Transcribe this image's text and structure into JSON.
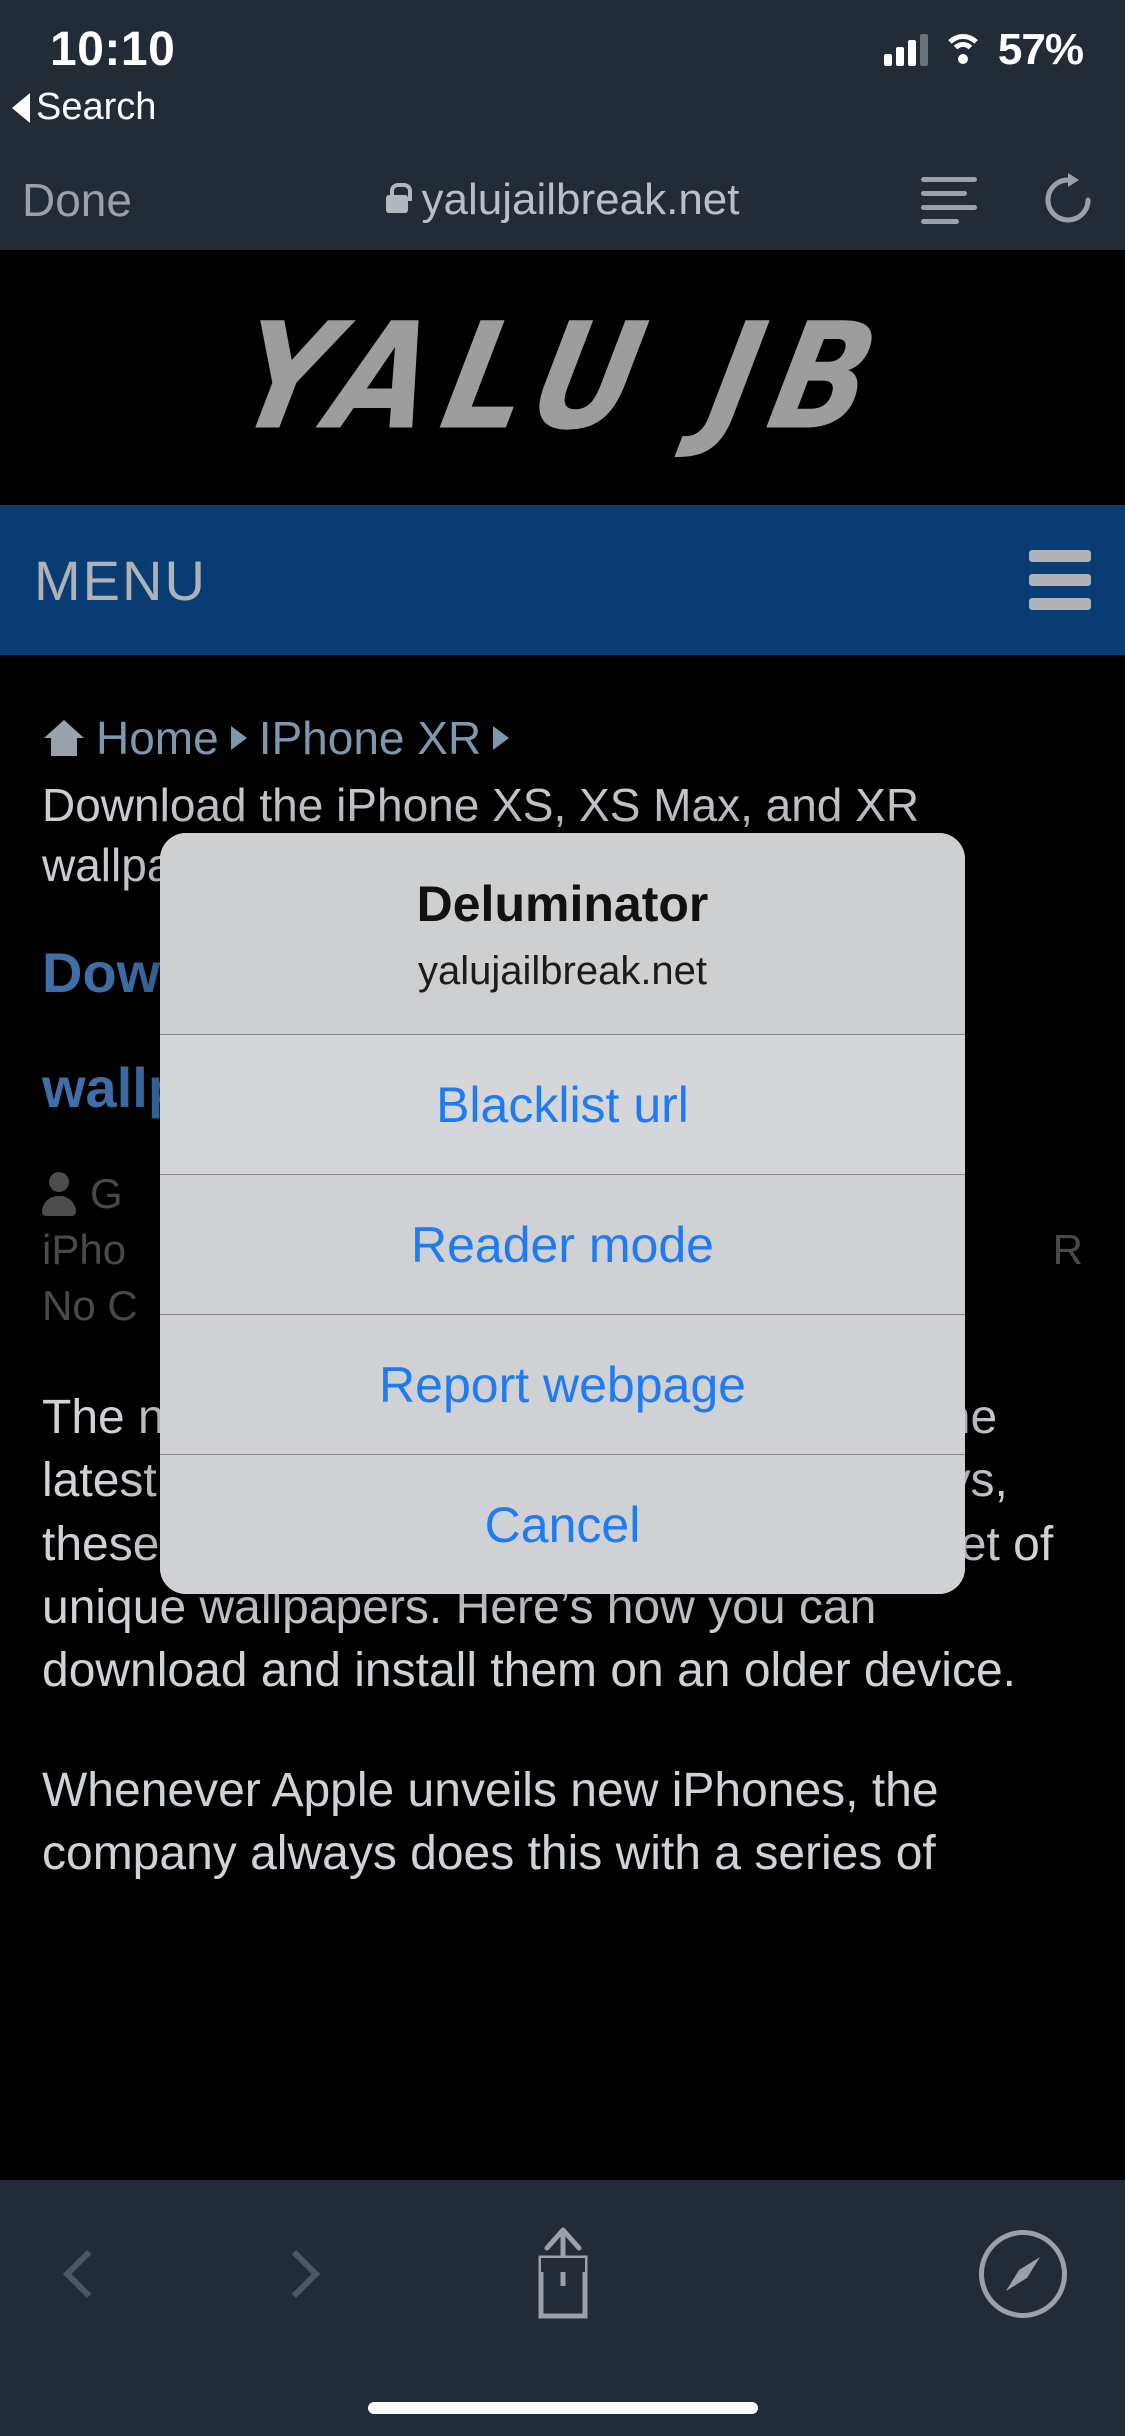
{
  "status_bar": {
    "time": "10:10",
    "back_label": "Search",
    "battery": "57%",
    "cellular_icon": "cellular-bars-icon",
    "wifi_icon": "wifi-icon"
  },
  "browser": {
    "done_label": "Done",
    "url": "yalujailbreak.net",
    "lock_icon": "lock-icon",
    "reader_icon": "reader-view-icon",
    "reload_icon": "reload-icon"
  },
  "site": {
    "logo_text": "YALU JB",
    "menu_label": "MENU",
    "hamburger_icon": "hamburger-menu-icon",
    "menu_bar_color": "#0a3c74",
    "breadcrumb": {
      "home_icon": "home-icon",
      "items": [
        "Home",
        "IPhone XR"
      ],
      "separator_icon": "caret-right-icon"
    }
  },
  "article": {
    "intro_line1": "Download the iPhone XS, XS Max, and XR",
    "intro_line2": "wallpapers",
    "title_line1": "Download the iPhone XS, XS Max",
    "title_line2": "wallpapers",
    "author_icon": "person-icon",
    "author": "G",
    "meta_line2_left": "iPho",
    "meta_line2_right": "R",
    "meta_line3": "No C",
    "paragraph1": "The new iPhone XS, XS Max and XR are the latest flagship devices from Apple. As always, these new smartphones come with a new set of unique wallpapers. Here’s how you can download and install them on an older device.",
    "paragraph2": "Whenever Apple unveils new iPhones, the company always does this with a series of"
  },
  "action_sheet": {
    "title": "Deluminator",
    "subtitle": "yalujailbreak.net",
    "buttons": [
      "Blacklist url",
      "Reader mode",
      "Report webpage",
      "Cancel"
    ],
    "accent_color": "#1f7bf4"
  },
  "bottom_toolbar": {
    "back_icon": "chevron-left-icon",
    "forward_icon": "chevron-right-icon",
    "share_icon": "share-icon",
    "tabs_icon": "compass-icon",
    "home_indicator": "home-indicator"
  }
}
